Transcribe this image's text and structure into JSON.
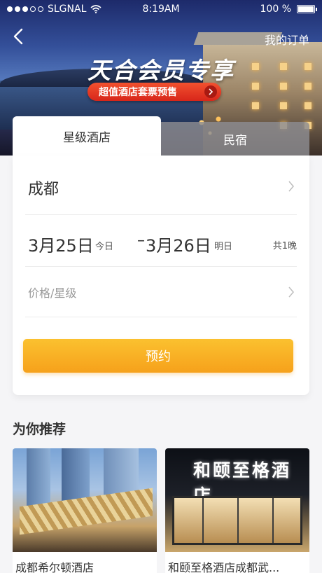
{
  "status_bar": {
    "carrier": "SLGNAL",
    "time": "8:19AM",
    "battery_percent": "100 %"
  },
  "header": {
    "my_orders_label": "我的订单",
    "promo_title": "天合会员专享",
    "promo_subtitle": "超值酒店套票预售"
  },
  "tabs": [
    {
      "label": "星级酒店",
      "active": true
    },
    {
      "label": "民宿",
      "active": false
    }
  ],
  "search": {
    "city": "成都",
    "check_in_date": "3月25日",
    "check_in_note": "今日",
    "date_separator": "–",
    "check_out_date": "3月26日",
    "check_out_note": "明日",
    "nights": "共1晚",
    "price_star_placeholder": "价格/星级",
    "book_label": "预约"
  },
  "recommendations": {
    "title": "为你推荐",
    "hotels": [
      {
        "name": "成都希尔顿酒店"
      },
      {
        "name": "和颐至格酒店成都武...",
        "sign_text": "和颐至格酒店"
      }
    ]
  },
  "colors": {
    "accent_orange": "#f6a11b",
    "promo_red": "#e03a22",
    "tab_inactive": "#8c8c91"
  }
}
